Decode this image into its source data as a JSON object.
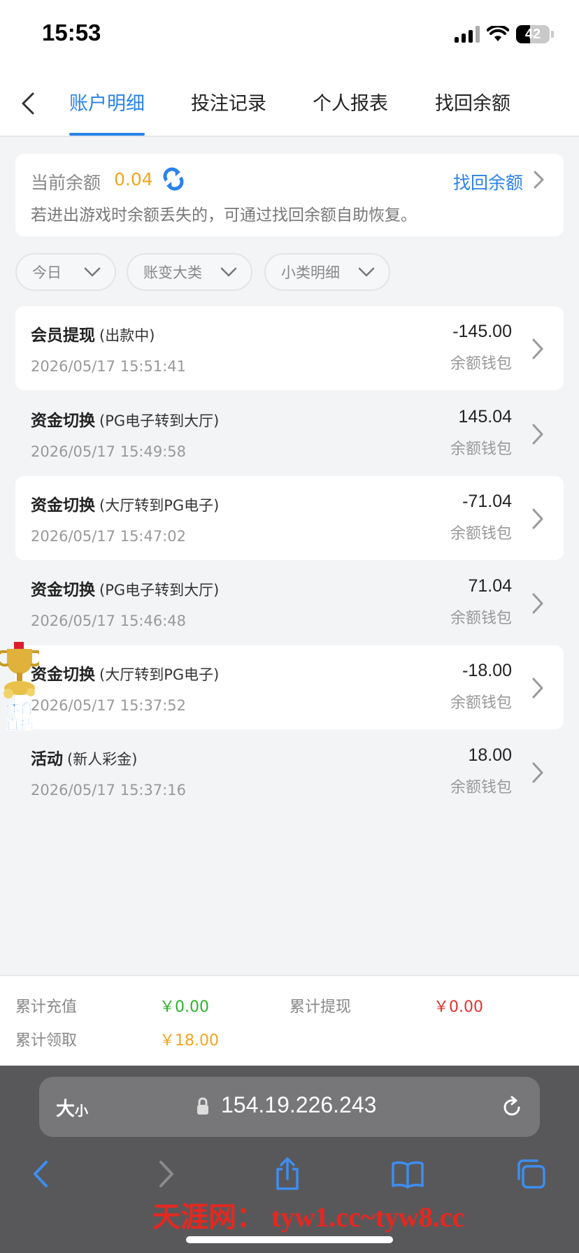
{
  "status_bar": {
    "time": "15:53",
    "battery": "42",
    "battery_level_percent": 42
  },
  "tabs": [
    {
      "label": "账户明细",
      "active": true
    },
    {
      "label": "投注记录",
      "active": false
    },
    {
      "label": "个人报表",
      "active": false
    },
    {
      "label": "找回余额",
      "active": false
    }
  ],
  "balance": {
    "label": "当前余额",
    "value": "0.04",
    "recover_link": "找回余额",
    "hint": "若进出游戏时余额丢失的，可通过找回余额自助恢复。"
  },
  "filters": [
    {
      "label": "今日"
    },
    {
      "label": "账变大类"
    },
    {
      "label": "小类明细"
    }
  ],
  "records": [
    {
      "title": "会员提现",
      "sub": "(出款中)",
      "date": "2026/05/17 15:51:41",
      "amount": "-145.00",
      "wallet": "余额钱包"
    },
    {
      "title": "资金切换",
      "sub": "(PG电子转到大厅)",
      "date": "2026/05/17 15:49:58",
      "amount": "145.04",
      "wallet": "余额钱包"
    },
    {
      "title": "资金切换",
      "sub": "(大厅转到PG电子)",
      "date": "2026/05/17 15:47:02",
      "amount": "-71.04",
      "wallet": "余额钱包"
    },
    {
      "title": "资金切换",
      "sub": "(PG电子转到大厅)",
      "date": "2026/05/17 15:46:48",
      "amount": "71.04",
      "wallet": "余额钱包"
    },
    {
      "title": "资金切换",
      "sub": "(大厅转到PG电子)",
      "date": "2026/05/17 15:37:52",
      "amount": "-18.00",
      "wallet": "余额钱包"
    },
    {
      "title": "活动",
      "sub": "(新人彩金)",
      "date": "2026/05/17 15:37:16",
      "amount": "18.00",
      "wallet": "余额钱包"
    }
  ],
  "float_badge": {
    "line1": "体育",
    "line2": "直播"
  },
  "totals": {
    "recharge_label": "累计充值",
    "recharge_value": "￥0.00",
    "withdraw_label": "累计提现",
    "withdraw_value": "￥0.00",
    "claim_label": "累计领取",
    "claim_value": "￥18.00"
  },
  "browser": {
    "text_size_big": "大",
    "text_size_small": "小",
    "url": "154.19.226.243",
    "watermark": "天涯网： tyw1.cc~tyw8.cc"
  },
  "colors": {
    "accent": "#2a83e8",
    "balance": "#f3a51c",
    "recharge": "#2db22d",
    "withdraw": "#e5312b",
    "claim": "#f3a51c"
  }
}
